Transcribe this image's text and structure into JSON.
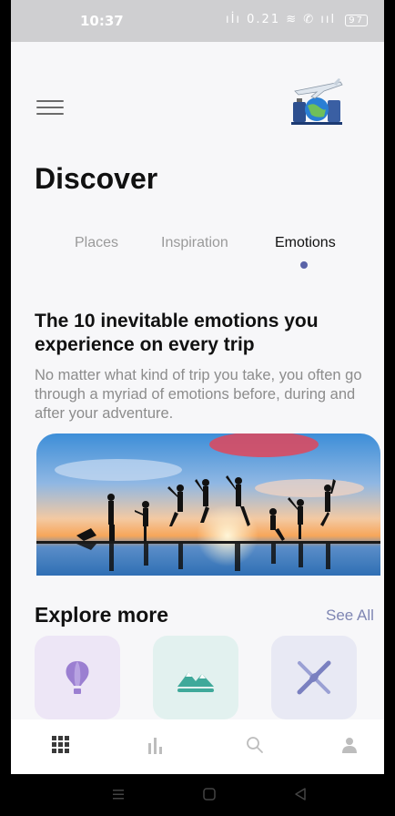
{
  "status_bar": {
    "time": "10:37",
    "icons_text": "ıİı 0.21 ≋ ✆ ııl",
    "battery": "97"
  },
  "header": {
    "menu_icon": "hamburger-menu-icon",
    "avatar_icon": "travel-airplane-avatar",
    "title": "Discover"
  },
  "tabs": [
    {
      "label": "Places",
      "active": false
    },
    {
      "label": "Inspiration",
      "active": false
    },
    {
      "label": "Emotions",
      "active": true
    }
  ],
  "article": {
    "title": "The 10 inevitable emotions you experience on every trip",
    "description": "No matter what kind of trip you take, you often go through a myriad of emotions before, during and after your adventure.",
    "image": "sunset-jumping-people-silhouette"
  },
  "explore": {
    "title": "Explore more",
    "see_all": "See All",
    "categories": [
      {
        "icon": "hot-air-balloon-icon",
        "color": "#9b7fd1"
      },
      {
        "icon": "mountains-icon",
        "color": "#3fa99a"
      },
      {
        "icon": "kayak-icon",
        "color": "#7a80c0"
      },
      {
        "icon": "more-icon",
        "color": "#f2c96a"
      }
    ]
  },
  "bottom_nav": [
    {
      "icon": "grid-icon",
      "active": true
    },
    {
      "icon": "stats-icon",
      "active": false
    },
    {
      "icon": "search-icon",
      "active": false
    },
    {
      "icon": "profile-icon",
      "active": false
    }
  ],
  "colors": {
    "accent": "#5a63a8",
    "background": "#f7f7f9",
    "status_bar": "#cfcfd1"
  }
}
